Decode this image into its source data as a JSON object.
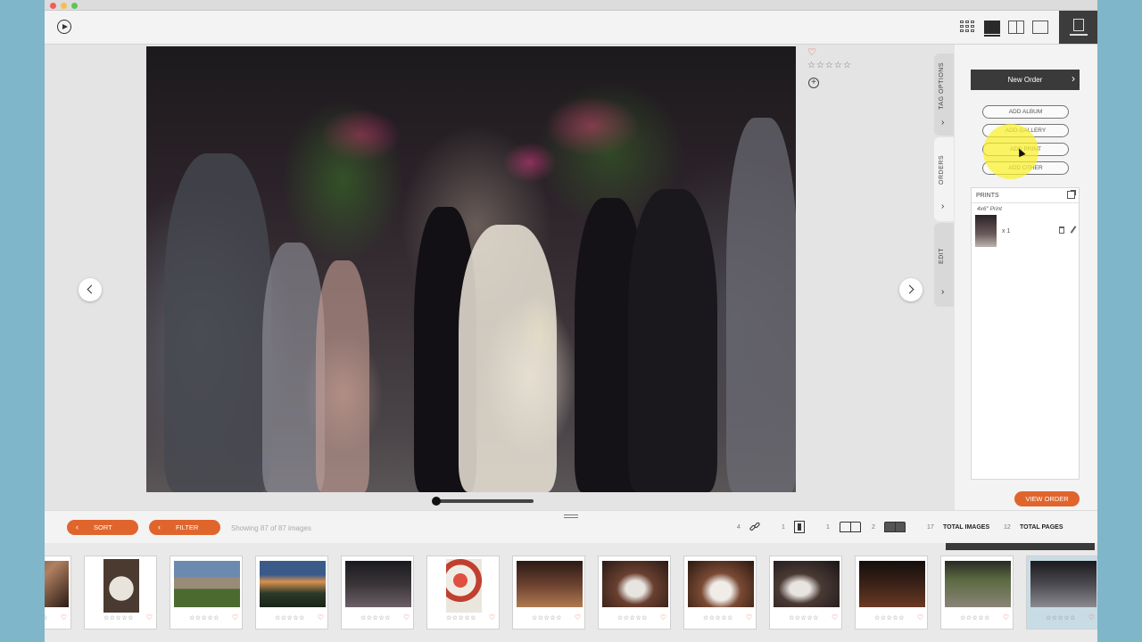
{
  "window": {
    "title": ""
  },
  "toolbar": {
    "view_modes": [
      "grid-view-icon",
      "loupe-view-icon",
      "compare-view-icon",
      "single-view-icon"
    ],
    "panel_toggle": "order-panel-icon"
  },
  "photo": {
    "rating_stars": "☆☆☆☆☆",
    "heart": "♡",
    "add_tag": "+"
  },
  "side_tabs": {
    "tag_options": "TAG OPTIONS",
    "orders": "ORDERS",
    "edit": "EDIT",
    "arrow": "›"
  },
  "order_panel": {
    "new_order": "New Order",
    "add_album": "ADD ALBUM",
    "add_gallery": "ADD GALLERY",
    "add_print": "ADD PRINT",
    "add_other": "ADD OTHER",
    "prints_header": "PRINTS",
    "print_type": "4x6\" Print",
    "print_qty": "x 1",
    "view_order": "VIEW ORDER"
  },
  "bottom_bar": {
    "sort": "SORT",
    "filter": "FILTER",
    "arrow": "‹",
    "showing": "Showing 87 of 87 images",
    "link_count": "4",
    "single_count": "1",
    "spread_count_a": "1",
    "spread_count_b": "2",
    "total_images_count": "17",
    "total_images_label": "TOTAL IMAGES",
    "total_pages_count": "12",
    "total_pages_label": "TOTAL PAGES"
  },
  "filmstrip": {
    "star_text": "☆☆☆☆☆",
    "heart": "♡"
  },
  "colors": {
    "accent": "#e0652d",
    "dark": "#3a3a3a"
  }
}
